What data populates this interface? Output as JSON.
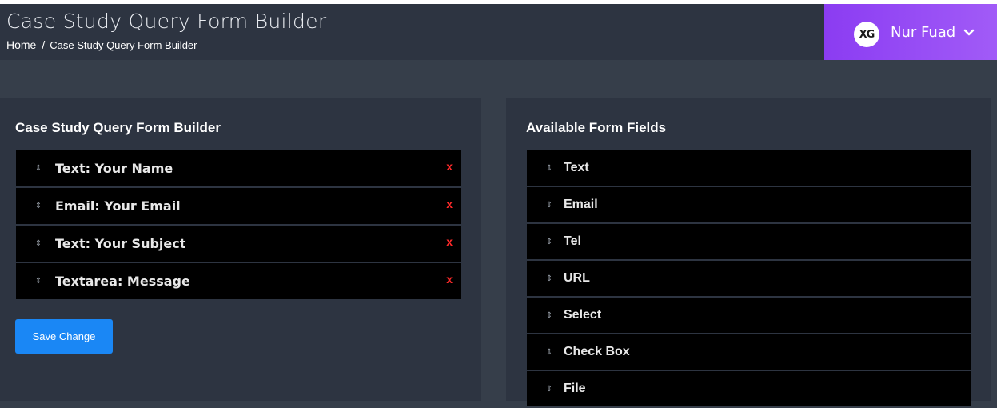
{
  "header": {
    "title": "Case Study Query Form Builder",
    "breadcrumb": {
      "home": "Home",
      "separator": "/",
      "current": "Case Study Query Form Builder"
    },
    "user": {
      "avatar_text": "XG",
      "name": "Nur Fuad"
    }
  },
  "builder": {
    "title": "Case Study Query Form Builder",
    "fields": [
      {
        "label": "Text: Your Name",
        "remove": "x"
      },
      {
        "label": "Email: Your Email",
        "remove": "x"
      },
      {
        "label": "Text: Your Subject",
        "remove": "x"
      },
      {
        "label": "Textarea: Message",
        "remove": "x"
      }
    ],
    "save_label": "Save Change"
  },
  "available": {
    "title": "Available Form Fields",
    "fields": [
      "Text",
      "Email",
      "Tel",
      "URL",
      "Select",
      "Check Box",
      "File"
    ]
  },
  "colors": {
    "header_bg": "#2d3441",
    "page_bg": "#363e4a",
    "accent_purple": "#8b3cf2",
    "primary_button": "#1a87f5",
    "remove_red": "#ff2a2a"
  }
}
